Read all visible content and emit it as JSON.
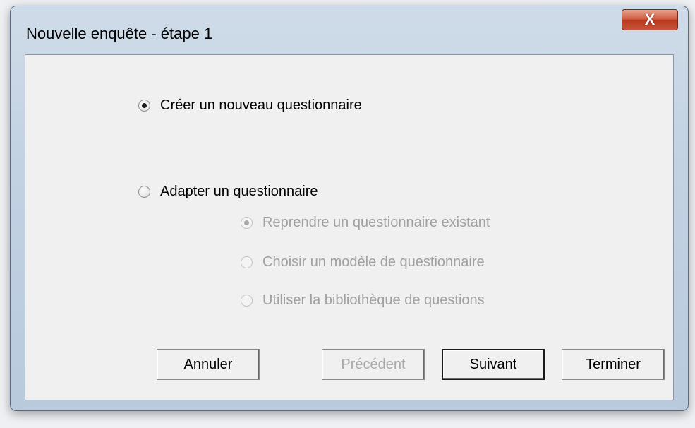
{
  "window": {
    "title": "Nouvelle enquête - étape 1",
    "close_label": "X"
  },
  "options": {
    "create_new": {
      "label": "Créer un nouveau questionnaire",
      "checked": true,
      "enabled": true
    },
    "adapt": {
      "label": "Adapter un questionnaire",
      "checked": false,
      "enabled": true
    },
    "sub_options": [
      {
        "label": "Reprendre un questionnaire existant",
        "checked": true,
        "enabled": false
      },
      {
        "label": "Choisir un modèle de questionnaire",
        "checked": false,
        "enabled": false
      },
      {
        "label": "Utiliser la bibliothèque de questions",
        "checked": false,
        "enabled": false
      }
    ]
  },
  "buttons": {
    "cancel": "Annuler",
    "previous": "Précédent",
    "next": "Suivant",
    "finish": "Terminer"
  }
}
